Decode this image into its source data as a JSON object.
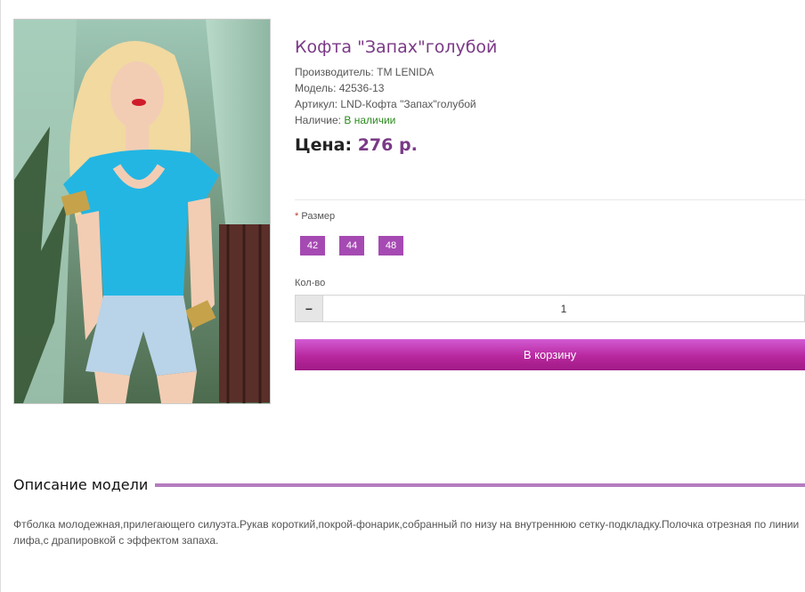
{
  "product": {
    "title": "Кофта \"Запах\"голубой",
    "manufacturer_label": "Производитель:",
    "manufacturer": "TM LENIDA",
    "model_label": "Модель:",
    "model": "42536-13",
    "sku_label": "Артикул:",
    "sku": "LND-Кофта \"Запах\"голубой",
    "availability_label": "Наличие:",
    "availability": "В наличии",
    "price_label": "Цена:",
    "price": "276 р."
  },
  "options": {
    "size_required_mark": "*",
    "size_label": "Размер",
    "sizes": [
      "42",
      "44",
      "48"
    ],
    "qty_label": "Кол-во",
    "qty_minus": "−",
    "qty_value": "1",
    "cart_button": "В корзину"
  },
  "description": {
    "heading": "Описание модели",
    "text": "Фтболка молодежная,прилегающего силуэта.Рукав короткий,покрой-фонарик,собранный по низу на внутреннюю сетку-подкладку.Полочка отрезная по линии лифа,с драпировкой с эффектом запаха."
  },
  "colors": {
    "accent": "#7a3a86",
    "size_button": "#a64ab3",
    "cart_button": "#b8279e",
    "in_stock": "#2b8a1e",
    "section_rule": "#b57cbf"
  }
}
